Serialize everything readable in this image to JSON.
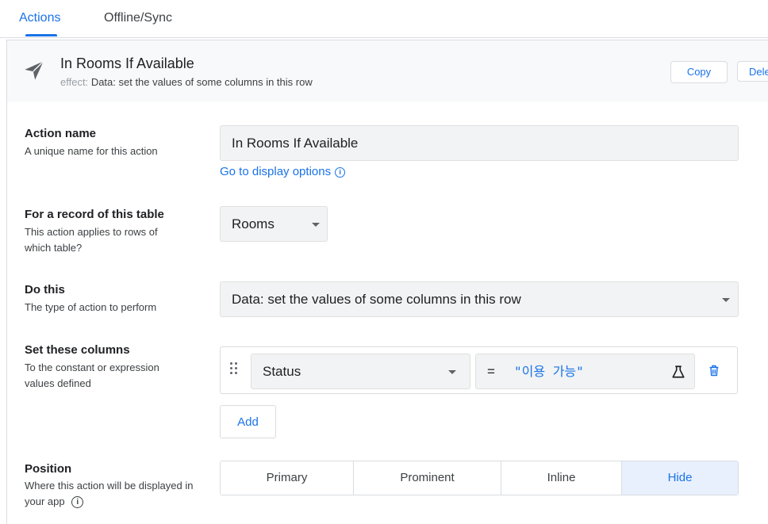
{
  "tabs": [
    {
      "label": "Actions",
      "active": true
    },
    {
      "label": "Offline/Sync",
      "active": false
    }
  ],
  "header": {
    "icon": "send-icon",
    "title": "In Rooms If Available",
    "effect_label": "effect:",
    "effect_value": "Data: set the values of some columns in this row",
    "copy_label": "Copy",
    "delete_label": "Dele"
  },
  "action_name": {
    "label": "Action name",
    "description": "A unique name for this action",
    "value": "In Rooms If Available",
    "link": "Go to display options"
  },
  "table": {
    "label": "For a record of this table",
    "description": "This action applies to rows of which table?",
    "value": "Rooms"
  },
  "do_this": {
    "label": "Do this",
    "description": "The type of action to perform",
    "value": "Data: set the values of some columns in this row"
  },
  "set_columns": {
    "label": "Set these columns",
    "description": "To the constant or expression values defined",
    "column": "Status",
    "operator": "=",
    "expression": "\"이용 가능\"",
    "add_label": "Add"
  },
  "position": {
    "label": "Position",
    "description": "Where this action will be displayed in your app",
    "options": [
      "Primary",
      "Prominent",
      "Inline",
      "Hide"
    ],
    "selected": "Hide"
  },
  "colors": {
    "accent": "#1a73e8",
    "selected_bg": "#e8f0fe",
    "field_bg": "#f1f3f4"
  }
}
